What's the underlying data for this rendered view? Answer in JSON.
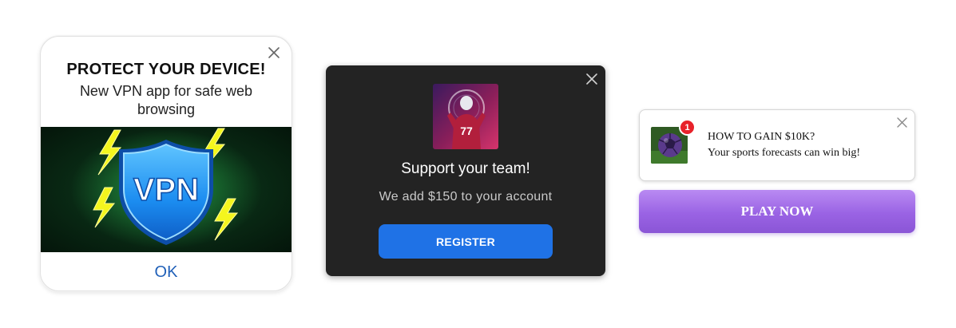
{
  "vpn_popup": {
    "title": "PROTECT YOUR DEVICE!",
    "subtitle": "New VPN app for safe web browsing",
    "shield_text": "VPN",
    "ok_label": "OK",
    "accent_color": "#2060b8"
  },
  "team_popup": {
    "title": "Support your team!",
    "subtitle": "We add $150 to your account",
    "register_label": "REGISTER",
    "button_color": "#1f72e6",
    "jersey_number": "77"
  },
  "notification": {
    "badge_count": "1",
    "title": "HOW TO GAIN $10K?",
    "subtitle": "Your sports forecasts can win big!",
    "play_label": "PLAY NOW",
    "badge_color": "#e8222a",
    "button_color": "#9a63e4"
  }
}
